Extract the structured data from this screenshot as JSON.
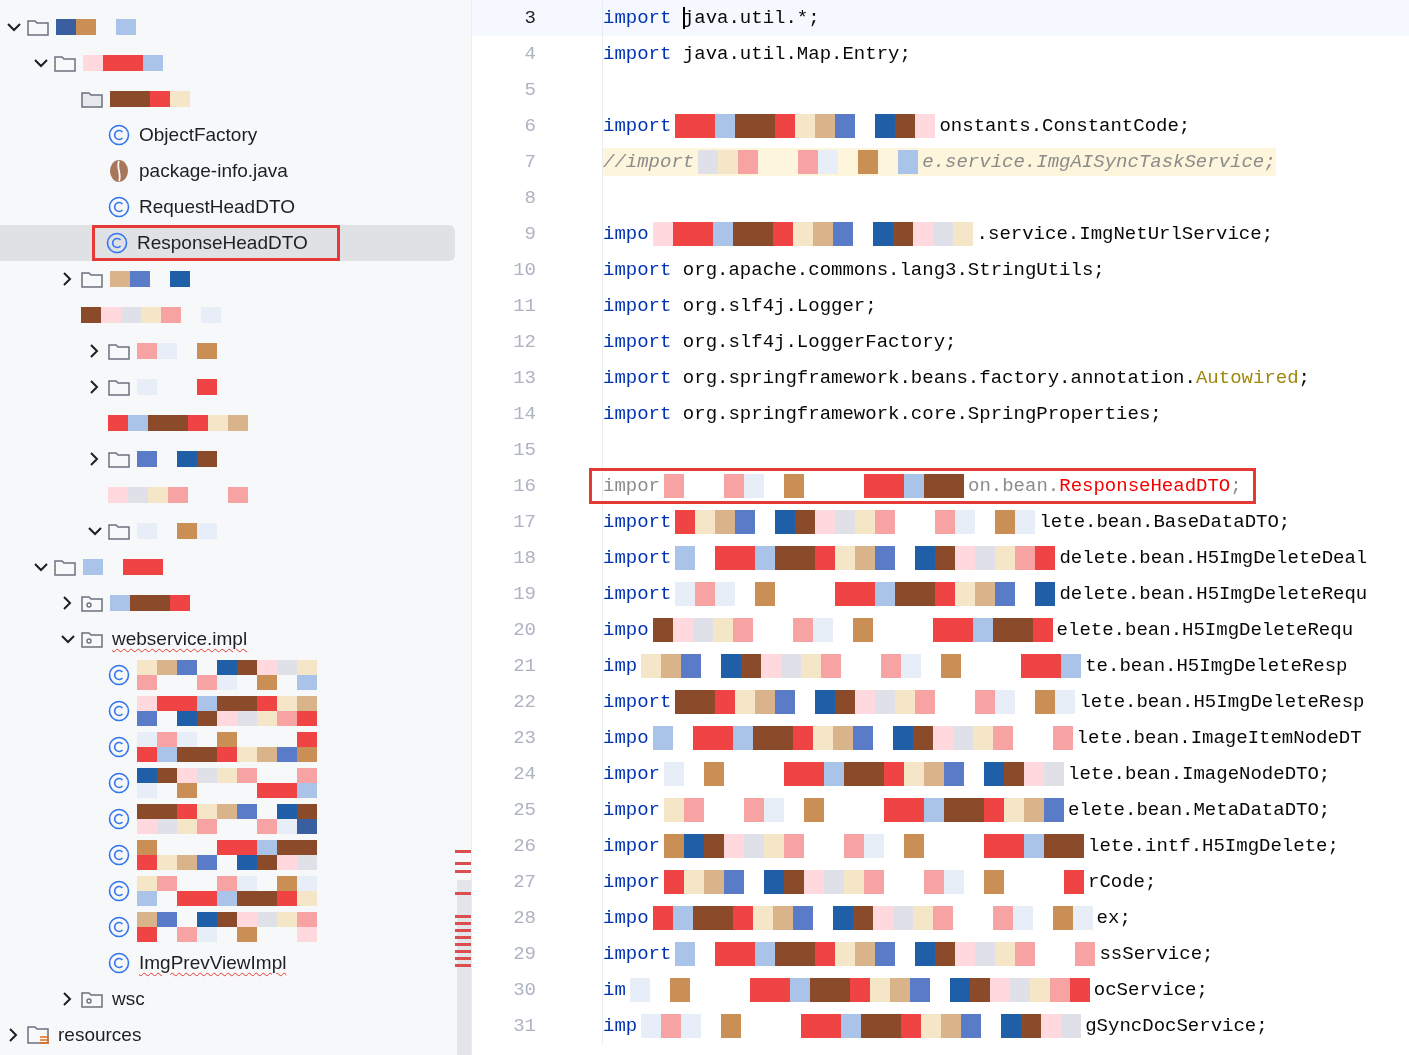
{
  "project_tree": [
    {
      "kind": "folder",
      "expanded": true,
      "children": [
        {
          "kind": "folder",
          "expanded": true,
          "children": [
            {
              "kind": "redacted-folder",
              "children": [
                {
                  "kind": "class",
                  "label": "ObjectFactory",
                  "selected": false,
                  "boxed": false
                },
                {
                  "kind": "java-file",
                  "label": "package-info.java",
                  "selected": false,
                  "boxed": false
                },
                {
                  "kind": "class",
                  "label": "RequestHeadDTO",
                  "selected": false,
                  "boxed": false
                },
                {
                  "kind": "class",
                  "label": "ResponseHeadDTO",
                  "selected": true,
                  "boxed": true
                }
              ]
            },
            {
              "kind": "folder",
              "expanded": false
            },
            {
              "kind": "redacted",
              "children": [
                {
                  "kind": "folder",
                  "expanded": false
                },
                {
                  "kind": "folder",
                  "expanded": false
                },
                {
                  "kind": "redacted"
                },
                {
                  "kind": "folder",
                  "expanded": false
                },
                {
                  "kind": "redacted"
                },
                {
                  "kind": "folder",
                  "expanded": true
                }
              ]
            }
          ]
        },
        {
          "kind": "folder",
          "expanded": true,
          "children": [
            {
              "kind": "package",
              "expanded": false
            },
            {
              "kind": "package",
              "label": "webservice.impl",
              "misspelled": true,
              "expanded": true,
              "children": [
                {
                  "kind": "redacted-class"
                },
                {
                  "kind": "redacted-class"
                },
                {
                  "kind": "redacted-class"
                },
                {
                  "kind": "redacted-class"
                },
                {
                  "kind": "redacted-class"
                },
                {
                  "kind": "redacted-class"
                },
                {
                  "kind": "redacted-class"
                },
                {
                  "kind": "redacted-class"
                },
                {
                  "kind": "class",
                  "label": "ImgPrevViewImpl",
                  "misspelled": true,
                  "selected": false,
                  "boxed": false
                }
              ]
            },
            {
              "kind": "package",
              "label": "wsc",
              "expanded": false
            }
          ]
        }
      ]
    },
    {
      "kind": "resources",
      "label": "resources",
      "expanded": false
    }
  ],
  "editor": {
    "lines": [
      {
        "number": "3",
        "current": true,
        "segments": [
          {
            "kind": "keyword",
            "text": "import"
          },
          {
            "kind": "code",
            "text": " java.util.*;",
            "caret": true
          }
        ]
      },
      {
        "number": "4",
        "segments": [
          {
            "kind": "keyword",
            "text": "import"
          },
          {
            "kind": "code",
            "text": " java.util.Map.Entry;"
          }
        ]
      },
      {
        "number": "5"
      },
      {
        "number": "6",
        "segments": [
          {
            "kind": "keyword",
            "text": "import"
          },
          {
            "kind": "redacted"
          },
          {
            "kind": "code",
            "text": "onstants.ConstantCode;"
          }
        ]
      },
      {
        "number": "7",
        "commented": true,
        "segments": [
          {
            "kind": "comment",
            "text": "//import"
          },
          {
            "kind": "redacted"
          },
          {
            "kind": "comment",
            "text": "e.service.ImgAISyncTaskService;"
          }
        ]
      },
      {
        "number": "8"
      },
      {
        "number": "9",
        "segments": [
          {
            "kind": "keyword",
            "text": "impo"
          },
          {
            "kind": "redacted"
          },
          {
            "kind": "code",
            "text": ".service.ImgNetUrlService;"
          }
        ]
      },
      {
        "number": "10",
        "segments": [
          {
            "kind": "keyword",
            "text": "import"
          },
          {
            "kind": "code",
            "text": " org.apache.commons.lang3.StringUtils;"
          }
        ]
      },
      {
        "number": "11",
        "segments": [
          {
            "kind": "keyword",
            "text": "import"
          },
          {
            "kind": "code",
            "text": " org.slf4j.Logger;"
          }
        ]
      },
      {
        "number": "12",
        "segments": [
          {
            "kind": "keyword",
            "text": "import"
          },
          {
            "kind": "code",
            "text": " org.slf4j.LoggerFactory;"
          }
        ]
      },
      {
        "number": "13",
        "segments": [
          {
            "kind": "keyword",
            "text": "import"
          },
          {
            "kind": "code",
            "text": " org.springframework.beans.factory.annotation."
          },
          {
            "kind": "annotation",
            "text": "Autowired"
          },
          {
            "kind": "code",
            "text": ";"
          }
        ]
      },
      {
        "number": "14",
        "segments": [
          {
            "kind": "keyword",
            "text": "import"
          },
          {
            "kind": "code",
            "text": " org.springframework.core.SpringProperties;"
          }
        ]
      },
      {
        "number": "15"
      },
      {
        "number": "16",
        "boxed": true,
        "segments": [
          {
            "kind": "unused",
            "text": "impor"
          },
          {
            "kind": "redacted"
          },
          {
            "kind": "unused",
            "text": "on.bean."
          },
          {
            "kind": "error",
            "text": "ResponseHeadDTO"
          },
          {
            "kind": "unused",
            "text": ";"
          }
        ]
      },
      {
        "number": "17",
        "segments": [
          {
            "kind": "keyword",
            "text": "import"
          },
          {
            "kind": "redacted"
          },
          {
            "kind": "code",
            "text": "lete.bean.BaseDataDTO;"
          }
        ]
      },
      {
        "number": "18",
        "segments": [
          {
            "kind": "keyword",
            "text": "import"
          },
          {
            "kind": "redacted"
          },
          {
            "kind": "code",
            "text": "delete.bean.H5ImgDeleteDeal"
          }
        ]
      },
      {
        "number": "19",
        "segments": [
          {
            "kind": "keyword",
            "text": "import"
          },
          {
            "kind": "redacted"
          },
          {
            "kind": "code",
            "text": "delete.bean.H5ImgDeleteRequ"
          }
        ]
      },
      {
        "number": "20",
        "segments": [
          {
            "kind": "keyword",
            "text": "impo"
          },
          {
            "kind": "redacted"
          },
          {
            "kind": "code",
            "text": "elete.bean.H5ImgDeleteRequ"
          }
        ]
      },
      {
        "number": "21",
        "segments": [
          {
            "kind": "keyword",
            "text": "imp"
          },
          {
            "kind": "redacted"
          },
          {
            "kind": "code",
            "text": "te.bean.H5ImgDeleteResp"
          }
        ]
      },
      {
        "number": "22",
        "segments": [
          {
            "kind": "keyword",
            "text": "import"
          },
          {
            "kind": "redacted"
          },
          {
            "kind": "code",
            "text": "lete.bean.H5ImgDeleteResp"
          }
        ]
      },
      {
        "number": "23",
        "segments": [
          {
            "kind": "keyword",
            "text": "impo"
          },
          {
            "kind": "redacted"
          },
          {
            "kind": "code",
            "text": "lete.bean.ImageItemNodeDT"
          }
        ]
      },
      {
        "number": "24",
        "segments": [
          {
            "kind": "keyword",
            "text": "impor"
          },
          {
            "kind": "redacted"
          },
          {
            "kind": "code",
            "text": "lete.bean.ImageNodeDTO;"
          }
        ]
      },
      {
        "number": "25",
        "segments": [
          {
            "kind": "keyword",
            "text": "impor"
          },
          {
            "kind": "redacted"
          },
          {
            "kind": "code",
            "text": "elete.bean.MetaDataDTO;"
          }
        ]
      },
      {
        "number": "26",
        "segments": [
          {
            "kind": "keyword",
            "text": "impor"
          },
          {
            "kind": "redacted"
          },
          {
            "kind": "code",
            "text": "lete.intf.H5ImgDelete;"
          }
        ]
      },
      {
        "number": "27",
        "segments": [
          {
            "kind": "keyword",
            "text": "impor"
          },
          {
            "kind": "redacted"
          },
          {
            "kind": "code",
            "text": "rCode;"
          }
        ]
      },
      {
        "number": "28",
        "segments": [
          {
            "kind": "keyword",
            "text": "impo"
          },
          {
            "kind": "redacted"
          },
          {
            "kind": "code",
            "text": "ex;"
          }
        ]
      },
      {
        "number": "29",
        "segments": [
          {
            "kind": "keyword",
            "text": "import"
          },
          {
            "kind": "redacted"
          },
          {
            "kind": "code",
            "text": "ssService;"
          }
        ]
      },
      {
        "number": "30",
        "segments": [
          {
            "kind": "keyword",
            "text": "im"
          },
          {
            "kind": "redacted"
          },
          {
            "kind": "code",
            "text": "ocService;"
          }
        ]
      },
      {
        "number": "31",
        "segments": [
          {
            "kind": "keyword",
            "text": "imp"
          },
          {
            "kind": "redacted"
          },
          {
            "kind": "code",
            "text": "gSyncDocService;"
          }
        ]
      }
    ]
  }
}
